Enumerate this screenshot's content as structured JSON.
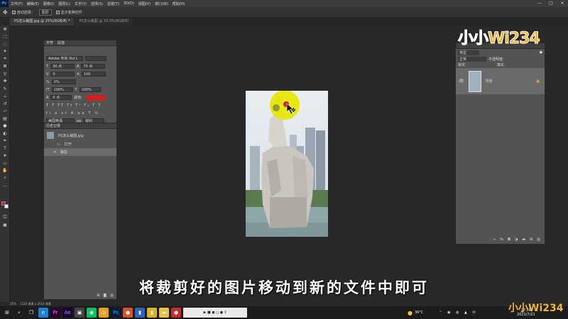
{
  "app": {
    "logo": "Ps"
  },
  "menu": [
    "文件(F)",
    "编辑(E)",
    "图像(I)",
    "图层(L)",
    "文字(Y)",
    "选择(S)",
    "滤镜(T)",
    "3D(D)",
    "视图(V)",
    "窗口(W)",
    "帮助(H)"
  ],
  "window_controls": {
    "minimize": "—",
    "maximize": "□",
    "close": "✕"
  },
  "options": {
    "auto_select": "自动选择：",
    "group": "图层",
    "transform": "显示变换控件"
  },
  "tabs": [
    {
      "label": "PS怎么裁图.jpg @ 25%(RGB/8) *"
    },
    {
      "label": "PS怎么裁图 @ 33.3%(RGB/8)"
    }
  ],
  "char_panel": {
    "tabs": [
      "字符",
      "段落"
    ],
    "font": "Adobe 宋体 Std L",
    "size": "30 点",
    "leading": "75 点",
    "kerning": "0",
    "tracking": "100",
    "scale_pct": "0%",
    "v_scale": "100%",
    "h_scale": "100%",
    "baseline": "0 点",
    "color_label": "颜色：",
    "lang": "美国英语",
    "aa": "锐利"
  },
  "history_panel": {
    "title": "历史记录",
    "snapshot": "PS怎么裁图.jpg",
    "items": [
      {
        "label": "打开"
      },
      {
        "label": "裁剪"
      }
    ]
  },
  "layers_panel": {
    "kind": "类型",
    "mode": "正常",
    "opacity_label": "不透明度:",
    "lock_label": "锁定:",
    "fill_label": "填充:",
    "layer_name": "背景"
  },
  "status": {
    "zoom": "25%",
    "size": "1132 像素 x 2014 像素"
  },
  "subtitle": "将裁剪好的图片移动到新的文件中即可",
  "watermark": "小小Wi234",
  "tray": {
    "weather": "36°C",
    "time": "17:38",
    "date": "2021/7/21"
  },
  "colors": {
    "brand_blue": "#31a8ff",
    "fg_swatch": "#d11f1f",
    "bg_swatch": "#ffffff",
    "highlight": "#e6e600"
  }
}
